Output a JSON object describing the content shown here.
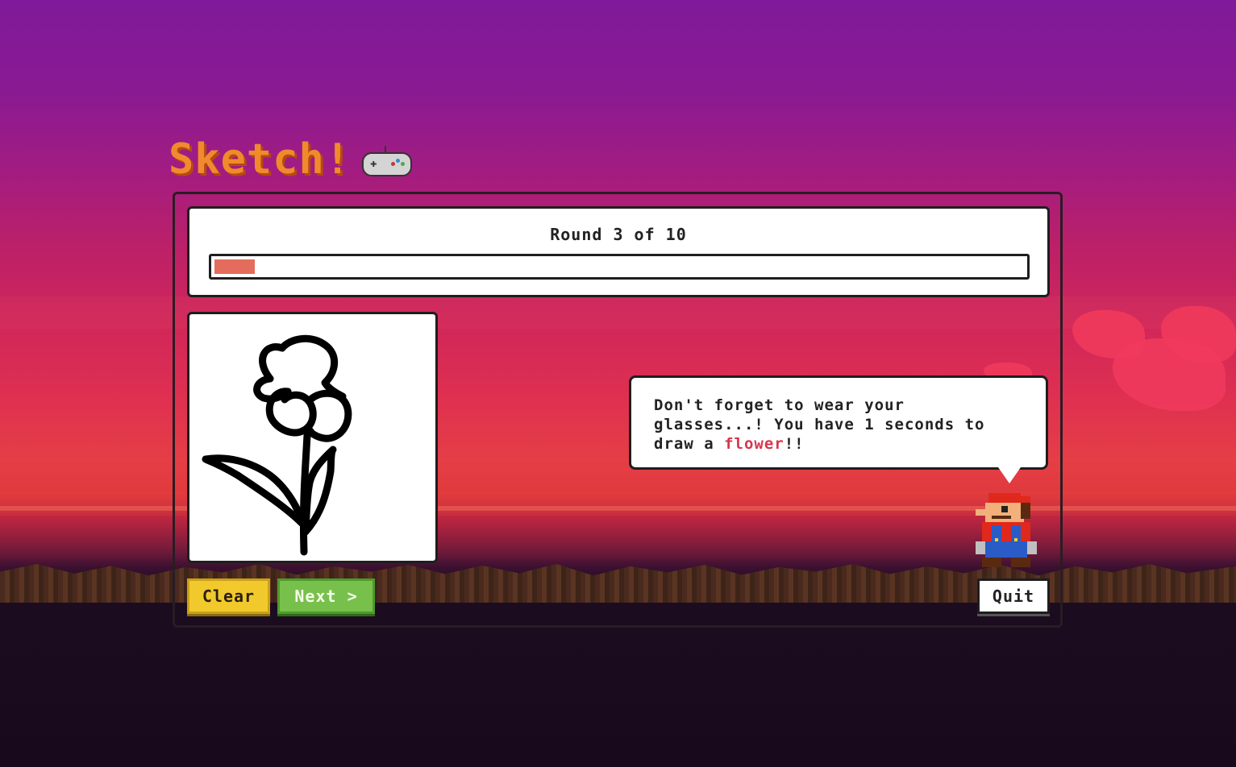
{
  "app": {
    "title": "Sketch!",
    "title_icon": "gamepad-icon"
  },
  "round": {
    "label": "Round 3 of 10",
    "progress_fraction": 0.05
  },
  "message": {
    "before": "Don't forget to wear your glasses...! You have 1 seconds to draw a ",
    "highlight": "flower",
    "after": "!!"
  },
  "buttons": {
    "clear": "Clear",
    "next": "Next >",
    "quit": "Quit"
  },
  "colors": {
    "accent": "#f08a2c",
    "progress": "#e46c5c",
    "highlight": "#d8344c",
    "clear_button": "#f2c92c",
    "next_button": "#78c04c"
  }
}
